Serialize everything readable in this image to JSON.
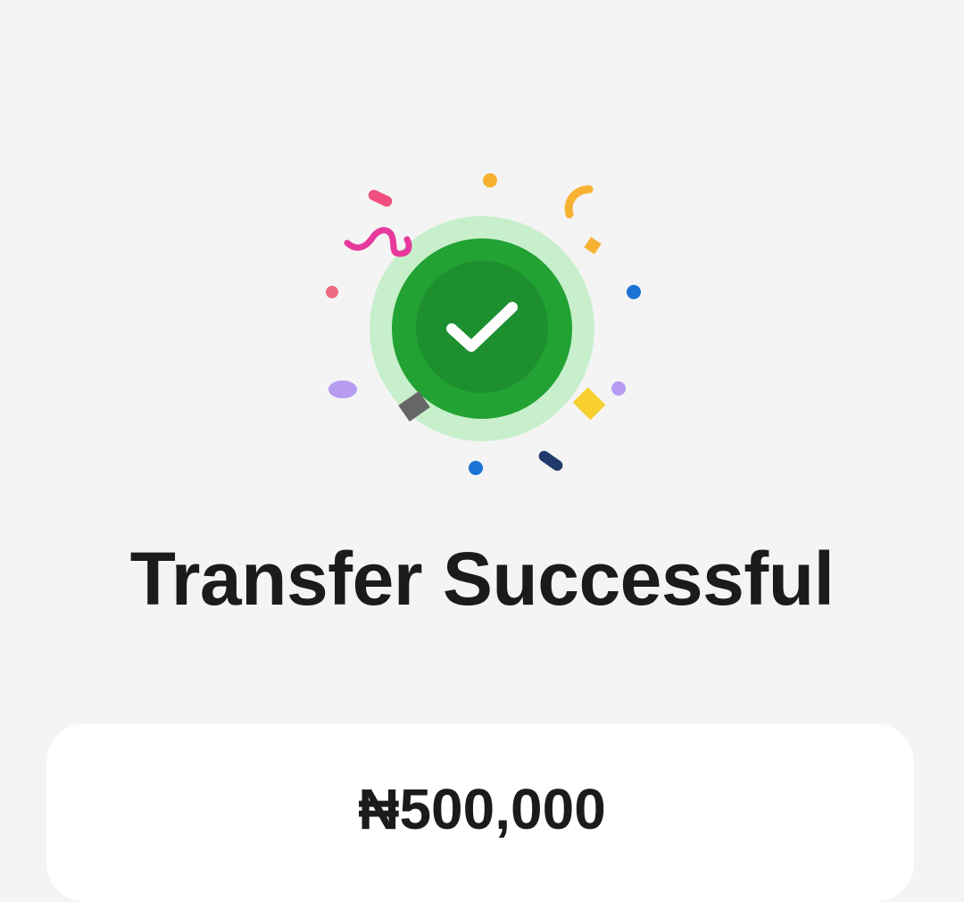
{
  "status": {
    "title": "Transfer Successful"
  },
  "summary_card": {
    "amount": "₦500,000"
  },
  "icons": {
    "success": "check-circle-icon",
    "decoration": "confetti"
  },
  "colors": {
    "background": "#f4f4f4",
    "success_green": "#1f9a34",
    "success_ring": "#c8efcc",
    "check": "#ffffff",
    "text": "#1b1b1b",
    "card": "#ffffff"
  }
}
